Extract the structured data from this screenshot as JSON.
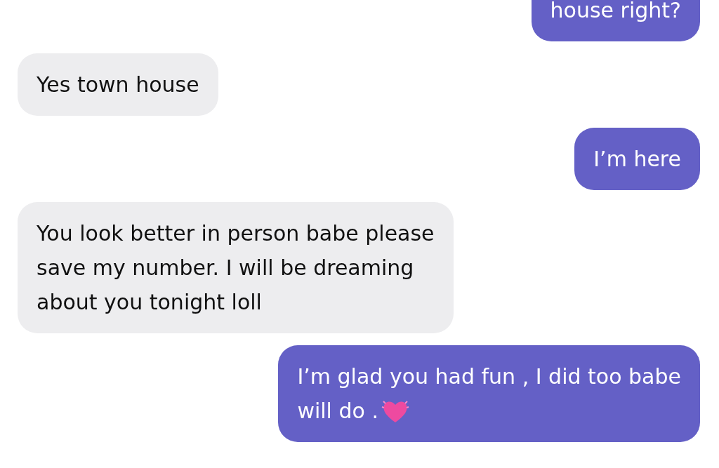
{
  "messages": [
    {
      "kind": "sent",
      "text": "house right?"
    },
    {
      "kind": "received",
      "text": "Yes town house"
    },
    {
      "kind": "sent",
      "text": "I’m here"
    },
    {
      "kind": "received",
      "text": "You look better in person babe please\nsave my number. I will be dreaming\nabout you tonight loll"
    },
    {
      "kind": "sent",
      "text": "I’m glad you had fun , I did too babe\nwill do .",
      "heart": true
    }
  ]
}
